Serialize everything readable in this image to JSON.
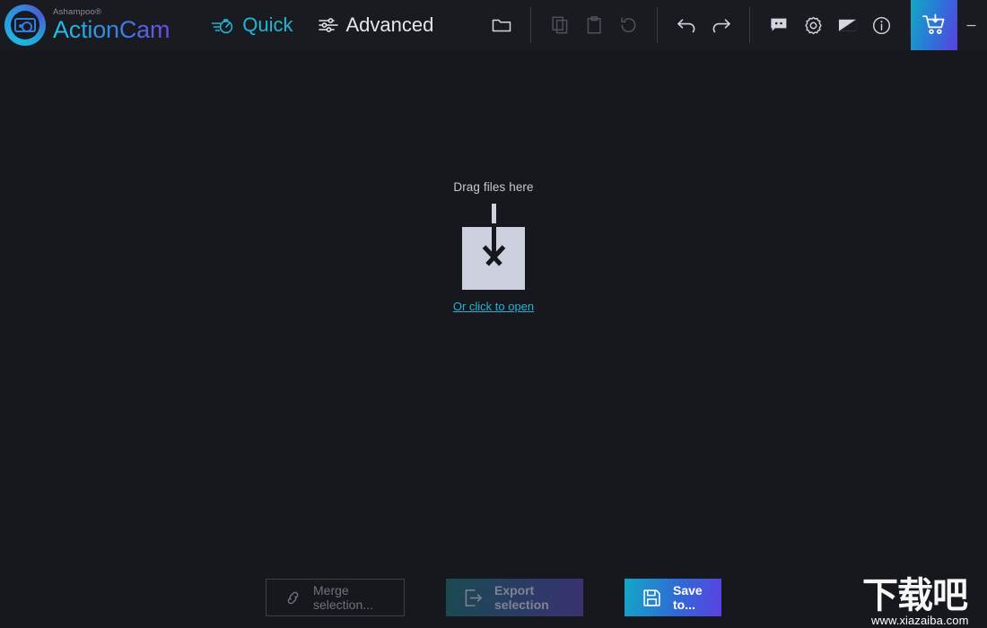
{
  "app": {
    "vendor": "Ashampoo®",
    "name": "ActionCam"
  },
  "modes": [
    {
      "id": "quick",
      "label": "Quick",
      "icon": "stopwatch-speed-icon",
      "active": true
    },
    {
      "id": "advanced",
      "label": "Advanced",
      "icon": "sliders-icon",
      "active": false
    }
  ],
  "toolbar": {
    "open_folder": {
      "label": "Open folder",
      "icon": "folder-icon",
      "enabled": true
    },
    "copy": {
      "label": "Copy",
      "icon": "copy-icon",
      "enabled": false
    },
    "paste": {
      "label": "Paste",
      "icon": "clipboard-icon",
      "enabled": false
    },
    "reset": {
      "label": "Reset",
      "icon": "reset-icon",
      "enabled": false
    },
    "undo": {
      "label": "Undo",
      "icon": "undo-icon",
      "enabled": true
    },
    "redo": {
      "label": "Redo",
      "icon": "redo-icon",
      "enabled": true
    }
  },
  "right_toolbar": {
    "feedback": {
      "label": "Feedback",
      "icon": "speech-bubble-stars-icon"
    },
    "settings": {
      "label": "Settings",
      "icon": "gear-icon"
    },
    "theme": {
      "label": "Theme",
      "icon": "contrast-square-icon"
    },
    "info": {
      "label": "Info",
      "icon": "info-circle-icon"
    },
    "cart": {
      "label": "Buy",
      "icon": "shopping-cart-download-icon"
    }
  },
  "window_controls": {
    "minimize": "─",
    "maximize": "□",
    "close": "✕"
  },
  "dropzone": {
    "title": "Drag files here",
    "link": "Or click to open",
    "icon": "download-arrow-into-box-icon"
  },
  "footer": {
    "merge": {
      "label": "Merge selection...",
      "icon": "chain-link-icon",
      "enabled": false
    },
    "export": {
      "label": "Export selection",
      "icon": "export-arrow-icon",
      "enabled": false
    },
    "save": {
      "label": "Save to...",
      "icon": "floppy-disk-icon",
      "enabled": true
    }
  },
  "watermark": {
    "text": "下载吧",
    "url": "www.xiazaiba.com"
  },
  "colors": {
    "background": "#17181e",
    "titlebar": "#1a1b21",
    "accent_teal": "#1fb5d4",
    "gradient_start": "#13a7c7",
    "gradient_end": "#5b41e2",
    "text_primary": "#e4e6ee",
    "text_dim": "#6e7180",
    "dropzone_box": "#cdd0de"
  }
}
